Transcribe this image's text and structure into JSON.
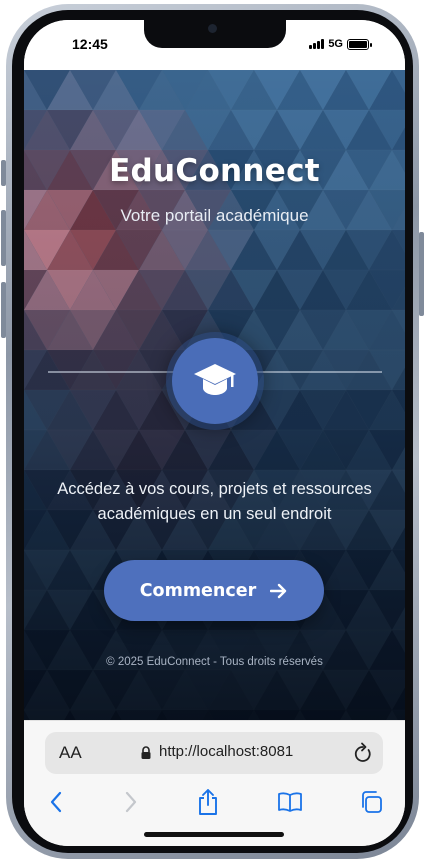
{
  "status_bar": {
    "time": "12:45",
    "network": "5G"
  },
  "hero": {
    "title": "EduConnect",
    "subtitle": "Votre portail académique",
    "center_icon": "graduation-cap-icon",
    "tagline": "Accédez à vos cours, projets et ressources académiques en un seul endroit",
    "cta_label": "Commencer",
    "cta_icon": "arrow-right-icon",
    "footer": "© 2025 EduConnect - Tous droits réservés"
  },
  "browser": {
    "text_size_label": "AA",
    "url": "http://localhost:8081",
    "icons": [
      "lock-icon",
      "reload-icon",
      "back-icon",
      "forward-icon",
      "share-icon",
      "bookmarks-icon",
      "tabs-icon"
    ]
  },
  "colors": {
    "accent": "#4e70bd",
    "icon_circle": "#4a6db8",
    "browser_tint": "#1a73e8"
  }
}
